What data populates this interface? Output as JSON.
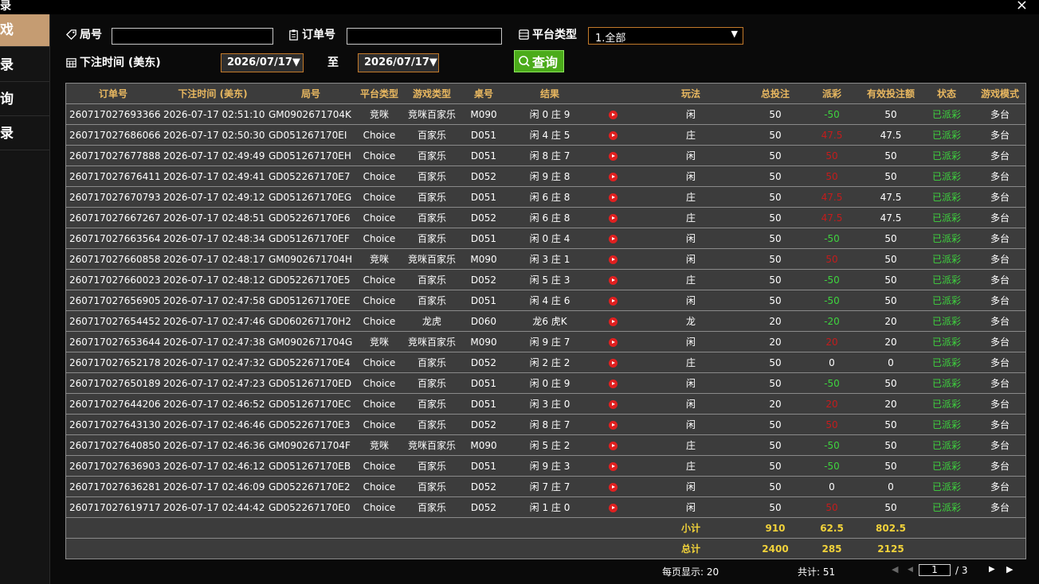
{
  "window": {
    "title_char": "录",
    "close_label": "×"
  },
  "sidebar": {
    "items": [
      {
        "label": "戏",
        "active": true
      },
      {
        "label": "录",
        "active": false
      },
      {
        "label": "询",
        "active": false
      },
      {
        "label": "录",
        "active": false
      }
    ]
  },
  "filters": {
    "round_label": "局号",
    "round_value": "",
    "order_label": "订单号",
    "order_value": "",
    "platform_label": "平台类型",
    "platform_value": "1.全部",
    "time_label": "下注时间 (美东)",
    "date_from": "2026/07/17",
    "to_label": "至",
    "date_to": "2026/07/17",
    "query_label": "查询"
  },
  "table": {
    "columns": [
      "订单号",
      "下注时间 (美东)",
      "局号",
      "平台类型",
      "游戏类型",
      "桌号",
      "结果",
      "",
      "玩法",
      "总投注",
      "派彩",
      "有效投注额",
      "状态",
      "游戏模式"
    ],
    "rows": [
      [
        "260717027693366",
        "2026-07-17 02:51:10",
        "GM0902671704K",
        "竞咪",
        "竞咪百家乐",
        "M090",
        "闲 0 庄 9",
        "闲",
        "50",
        "-50",
        "50",
        "已派彩",
        "多台"
      ],
      [
        "260717027686066",
        "2026-07-17 02:50:30",
        "GD051267170EI",
        "Choice",
        "百家乐",
        "D051",
        "闲 4 庄 5",
        "庄",
        "50",
        "47.5",
        "47.5",
        "已派彩",
        "多台"
      ],
      [
        "260717027677888",
        "2026-07-17 02:49:49",
        "GD051267170EH",
        "Choice",
        "百家乐",
        "D051",
        "闲 8 庄 7",
        "闲",
        "50",
        "50",
        "50",
        "已派彩",
        "多台"
      ],
      [
        "260717027676411",
        "2026-07-17 02:49:41",
        "GD052267170E7",
        "Choice",
        "百家乐",
        "D052",
        "闲 9 庄 8",
        "闲",
        "50",
        "50",
        "50",
        "已派彩",
        "多台"
      ],
      [
        "260717027670793",
        "2026-07-17 02:49:12",
        "GD051267170EG",
        "Choice",
        "百家乐",
        "D051",
        "闲 6 庄 8",
        "庄",
        "50",
        "47.5",
        "47.5",
        "已派彩",
        "多台"
      ],
      [
        "260717027667267",
        "2026-07-17 02:48:51",
        "GD052267170E6",
        "Choice",
        "百家乐",
        "D052",
        "闲 6 庄 8",
        "庄",
        "50",
        "47.5",
        "47.5",
        "已派彩",
        "多台"
      ],
      [
        "260717027663564",
        "2026-07-17 02:48:34",
        "GD051267170EF",
        "Choice",
        "百家乐",
        "D051",
        "闲 0 庄 4",
        "闲",
        "50",
        "-50",
        "50",
        "已派彩",
        "多台"
      ],
      [
        "260717027660858",
        "2026-07-17 02:48:17",
        "GM0902671704H",
        "竞咪",
        "竞咪百家乐",
        "M090",
        "闲 3 庄 1",
        "闲",
        "50",
        "50",
        "50",
        "已派彩",
        "多台"
      ],
      [
        "260717027660023",
        "2026-07-17 02:48:12",
        "GD052267170E5",
        "Choice",
        "百家乐",
        "D052",
        "闲 5 庄 3",
        "庄",
        "50",
        "-50",
        "50",
        "已派彩",
        "多台"
      ],
      [
        "260717027656905",
        "2026-07-17 02:47:58",
        "GD051267170EE",
        "Choice",
        "百家乐",
        "D051",
        "闲 4 庄 6",
        "闲",
        "50",
        "-50",
        "50",
        "已派彩",
        "多台"
      ],
      [
        "260717027654452",
        "2026-07-17 02:47:46",
        "GD060267170H2",
        "Choice",
        "龙虎",
        "D060",
        "龙6 虎K",
        "龙",
        "20",
        "-20",
        "20",
        "已派彩",
        "多台"
      ],
      [
        "260717027653644",
        "2026-07-17 02:47:38",
        "GM0902671704G",
        "竞咪",
        "竞咪百家乐",
        "M090",
        "闲 9 庄 7",
        "闲",
        "20",
        "20",
        "20",
        "已派彩",
        "多台"
      ],
      [
        "260717027652178",
        "2026-07-17 02:47:32",
        "GD052267170E4",
        "Choice",
        "百家乐",
        "D052",
        "闲 2 庄 2",
        "庄",
        "50",
        "0",
        "0",
        "已派彩",
        "多台"
      ],
      [
        "260717027650189",
        "2026-07-17 02:47:23",
        "GD051267170ED",
        "Choice",
        "百家乐",
        "D051",
        "闲 0 庄 9",
        "闲",
        "50",
        "-50",
        "50",
        "已派彩",
        "多台"
      ],
      [
        "260717027644206",
        "2026-07-17 02:46:52",
        "GD051267170EC",
        "Choice",
        "百家乐",
        "D051",
        "闲 3 庄 0",
        "闲",
        "20",
        "20",
        "20",
        "已派彩",
        "多台"
      ],
      [
        "260717027643130",
        "2026-07-17 02:46:46",
        "GD052267170E3",
        "Choice",
        "百家乐",
        "D052",
        "闲 8 庄 7",
        "闲",
        "50",
        "50",
        "50",
        "已派彩",
        "多台"
      ],
      [
        "260717027640850",
        "2026-07-17 02:46:36",
        "GM0902671704F",
        "竞咪",
        "竞咪百家乐",
        "M090",
        "闲 5 庄 2",
        "庄",
        "50",
        "-50",
        "50",
        "已派彩",
        "多台"
      ],
      [
        "260717027636903",
        "2026-07-17 02:46:12",
        "GD051267170EB",
        "Choice",
        "百家乐",
        "D051",
        "闲 9 庄 3",
        "庄",
        "50",
        "-50",
        "50",
        "已派彩",
        "多台"
      ],
      [
        "260717027636281",
        "2026-07-17 02:46:09",
        "GD052267170E2",
        "Choice",
        "百家乐",
        "D052",
        "闲 7 庄 7",
        "闲",
        "50",
        "0",
        "0",
        "已派彩",
        "多台"
      ],
      [
        "260717027619717",
        "2026-07-17 02:44:42",
        "GD052267170E0",
        "Choice",
        "百家乐",
        "D052",
        "闲 1 庄 0",
        "闲",
        "50",
        "50",
        "50",
        "已派彩",
        "多台"
      ]
    ],
    "payout_colors": [
      "g",
      "r",
      "r",
      "r",
      "r",
      "r",
      "g",
      "r",
      "g",
      "g",
      "g",
      "r",
      "w",
      "g",
      "r",
      "r",
      "g",
      "g",
      "w",
      "r"
    ],
    "subtotal": {
      "label": "小计",
      "bet": "910",
      "payout": "62.5",
      "valid": "802.5"
    },
    "total": {
      "label": "总计",
      "bet": "2400",
      "payout": "285",
      "valid": "2125"
    }
  },
  "pagination": {
    "per_page_label": "每页显示: 20",
    "total_label": "共计: 51",
    "current_page": "1",
    "total_pages": "/  3"
  },
  "colors": {
    "accent": "#c59c72",
    "header_text": "#e9b860",
    "positive": "#3ed43e",
    "negative": "#c41c1c",
    "status": "#3ed43e",
    "sum_text": "#f1d23a",
    "query_button": "#4bab1a"
  }
}
